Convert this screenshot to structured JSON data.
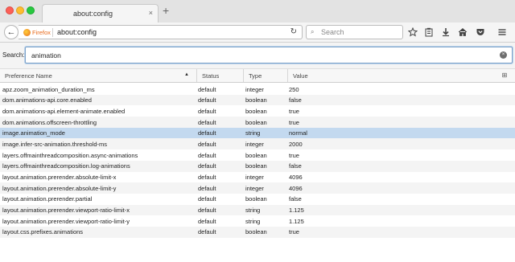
{
  "window": {
    "tab_title": "about:config",
    "tab_close": "×",
    "new_tab": "+"
  },
  "nav": {
    "back_icon": "←",
    "identity_label": "Firefox",
    "url": "about:config",
    "reload_icon": "↻",
    "search_placeholder": "Search",
    "search_icon": "⌕",
    "toolbar_icons": [
      "star-icon",
      "reading-list-icon",
      "download-icon",
      "home-icon",
      "pocket-icon",
      "menu-icon"
    ]
  },
  "config_search": {
    "label": "Search:",
    "value": "animation",
    "clear_icon": "×"
  },
  "table": {
    "columns": [
      "Preference Name",
      "Status",
      "Type",
      "Value"
    ],
    "sort_indicator": "▲",
    "column_picker_icon": "⊞",
    "selected_row": 4,
    "rows": [
      {
        "name": "apz.zoom_animation_duration_ms",
        "status": "default",
        "type": "integer",
        "value": "250"
      },
      {
        "name": "dom.animations-api.core.enabled",
        "status": "default",
        "type": "boolean",
        "value": "false"
      },
      {
        "name": "dom.animations-api.element-animate.enabled",
        "status": "default",
        "type": "boolean",
        "value": "true"
      },
      {
        "name": "dom.animations.offscreen-throttling",
        "status": "default",
        "type": "boolean",
        "value": "true"
      },
      {
        "name": "image.animation_mode",
        "status": "default",
        "type": "string",
        "value": "normal"
      },
      {
        "name": "image.infer-src-animation.threshold-ms",
        "status": "default",
        "type": "integer",
        "value": "2000"
      },
      {
        "name": "layers.offmainthreadcomposition.async-animations",
        "status": "default",
        "type": "boolean",
        "value": "true"
      },
      {
        "name": "layers.offmainthreadcomposition.log-animations",
        "status": "default",
        "type": "boolean",
        "value": "false"
      },
      {
        "name": "layout.animation.prerender.absolute-limit-x",
        "status": "default",
        "type": "integer",
        "value": "4096"
      },
      {
        "name": "layout.animation.prerender.absolute-limit-y",
        "status": "default",
        "type": "integer",
        "value": "4096"
      },
      {
        "name": "layout.animation.prerender.partial",
        "status": "default",
        "type": "boolean",
        "value": "false"
      },
      {
        "name": "layout.animation.prerender.viewport-ratio-limit-x",
        "status": "default",
        "type": "string",
        "value": "1.125"
      },
      {
        "name": "layout.animation.prerender.viewport-ratio-limit-y",
        "status": "default",
        "type": "string",
        "value": "1.125"
      },
      {
        "name": "layout.css.prefixes.animations",
        "status": "default",
        "type": "boolean",
        "value": "true"
      }
    ]
  },
  "colors": {
    "selected_row": "#c3d9ef",
    "firefox_orange": "#e96b1c"
  }
}
